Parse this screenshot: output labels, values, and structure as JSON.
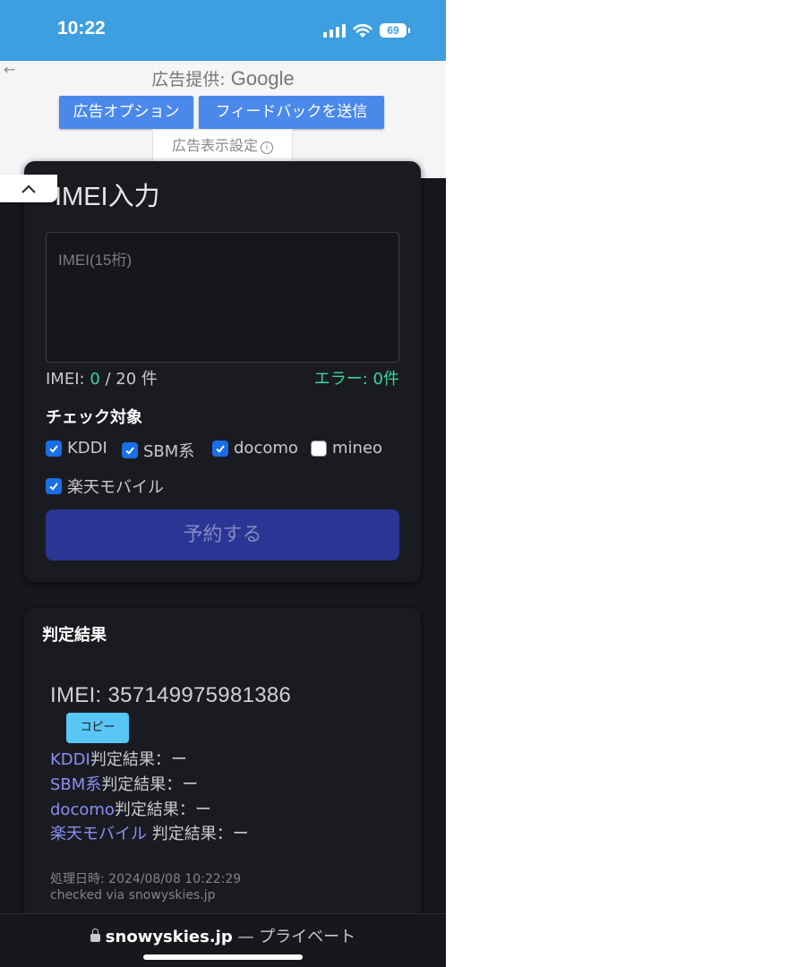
{
  "status_bar": {
    "time": "10:22",
    "battery": "69"
  },
  "ad": {
    "provider_prefix": "広告提供: ",
    "provider_name": "Google",
    "options_button": "広告オプション",
    "feedback_button": "フィードバックを送信",
    "settings_button": "広告表示設定",
    "back_icon": "←",
    "collapse_icon": "^"
  },
  "input_card": {
    "title": "IMEI入力",
    "textarea_placeholder": "IMEI(15桁)",
    "counter_label": "IMEI: ",
    "counter_value": "0",
    "counter_suffix": " / 20 件",
    "error_label": "エラー: 0件",
    "check_title": "チェック対象",
    "checks": [
      {
        "label": "KDDI",
        "checked": true
      },
      {
        "label": "SBM系",
        "checked": true
      },
      {
        "label": "docomo",
        "checked": true
      },
      {
        "label": "mineo",
        "checked": false
      },
      {
        "label": "楽天モバイル",
        "checked": true
      }
    ],
    "reserve_button": "予約する"
  },
  "result_card": {
    "title": "判定結果",
    "imei": "IMEI: 357149975981386",
    "copy_button": "コピー",
    "results": [
      {
        "carrier": "KDDI",
        "text": "判定結果：ー"
      },
      {
        "carrier": "SBM系",
        "text": "判定結果：ー"
      },
      {
        "carrier": "docomo",
        "text": "判定結果：ー"
      },
      {
        "carrier": "楽天モバイル",
        "text": " 判定結果：ー"
      }
    ],
    "processed_at": "処理日時: 2024/08/08 10:22:29",
    "checked_via": "checked via snowyskies.jp"
  },
  "bottom_bar": {
    "domain": "snowyskies.jp",
    "suffix": " — プライベート"
  },
  "colors": {
    "status_bar": "#3d9ee0",
    "accent_button": "#4a88ea",
    "checkbox_on": "#1a6ee8",
    "reserve_button": "#2b3594",
    "ok_green": "#3cd699",
    "carrier_link": "#8a8ef5",
    "copy_button": "#58c7f5"
  }
}
